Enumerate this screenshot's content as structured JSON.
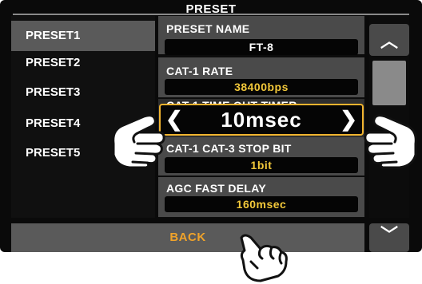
{
  "window": {
    "title": "PRESET"
  },
  "sidebar": {
    "items": [
      {
        "label": "PRESET1",
        "selected": true
      },
      {
        "label": "PRESET2",
        "selected": false
      },
      {
        "label": "PRESET3",
        "selected": false
      },
      {
        "label": "PRESET4",
        "selected": false
      },
      {
        "label": "PRESET5",
        "selected": false
      }
    ]
  },
  "settings": {
    "preset_name": {
      "label": "PRESET NAME",
      "value": "FT-8"
    },
    "cat1_rate": {
      "label": "CAT-1 RATE",
      "value": "38400bps"
    },
    "cat1_timeout": {
      "label": "CAT-1 TIME OUT TIMER",
      "value": "10msec",
      "left_arrow": "❮",
      "right_arrow": "❯"
    },
    "stop_bit": {
      "label": "CAT-1 CAT-3 STOP BIT",
      "value": "1bit"
    },
    "agc_fast_delay": {
      "label": "AGC FAST DELAY",
      "value": "160msec"
    }
  },
  "scroll": {
    "up_icon": "chevron-up-icon",
    "down_icon": "chevron-down-icon",
    "up_glyph": "︿",
    "down_glyph": "﹀"
  },
  "footer": {
    "back_label": "BACK"
  },
  "colors": {
    "accent_yellow": "#f2c83a",
    "focus_border": "#f0b32e",
    "back_text": "#f0a32a",
    "panel": "#4a4a4a"
  }
}
